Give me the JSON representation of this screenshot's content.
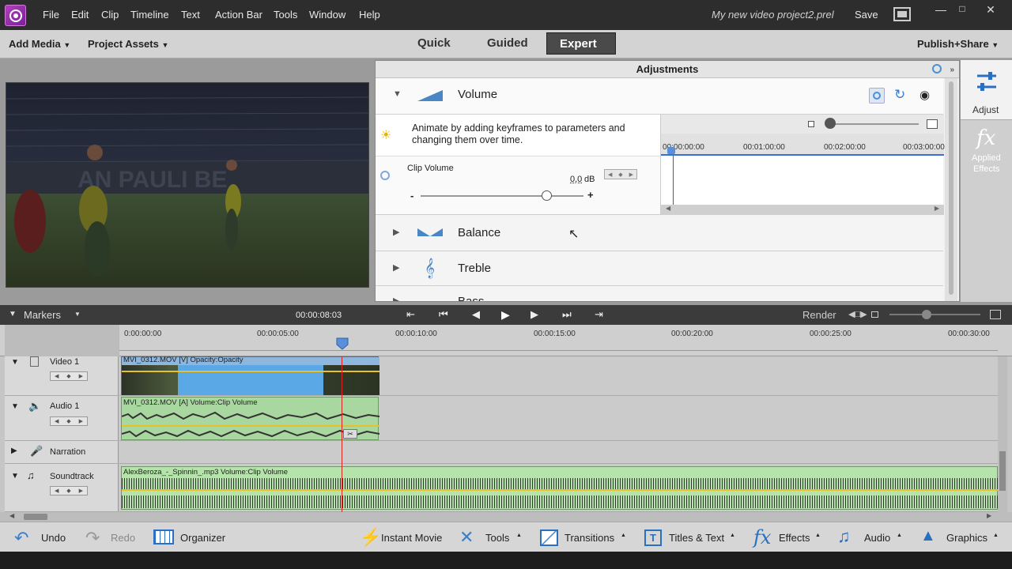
{
  "titlebar": {
    "menus": [
      "File",
      "Edit",
      "Clip",
      "Timeline",
      "Text",
      "Action Bar",
      "Tools",
      "Window",
      "Help"
    ],
    "project_name": "My new video project2.prel",
    "save_label": "Save"
  },
  "toolbar": {
    "add_media": "Add Media",
    "project_assets": "Project Assets",
    "modes": [
      "Quick",
      "Guided",
      "Expert"
    ],
    "active_mode": "Expert",
    "publish": "Publish+Share"
  },
  "adjustments": {
    "title": "Adjustments",
    "volume": {
      "label": "Volume",
      "tip": "Animate by adding keyframes to parameters and changing them over time.",
      "param_label": "Clip Volume",
      "value": "0,0",
      "unit": "dB",
      "minus": "-",
      "plus": "+",
      "slider_fraction": 0.77
    },
    "kf_times": [
      "00:00:00:00",
      "00:01:00:00",
      "00:02:00:00",
      "00:03:00:00"
    ],
    "sections": [
      "Balance",
      "Treble",
      "Bass"
    ]
  },
  "rightpanel": {
    "adjust": "Adjust",
    "applied_effects_1": "Applied",
    "applied_effects_2": "Effects",
    "fx": "fx"
  },
  "transport": {
    "markers": "Markers",
    "timecode": "00:00:08:03",
    "render": "Render"
  },
  "ruler": {
    "ticks": [
      "0:00:00:00",
      "00:00:05:00",
      "00:00:10:00",
      "00:00:15:00",
      "00:00:20:00",
      "00:00:25:00",
      "00:00:30:00"
    ]
  },
  "tracks": [
    {
      "name": "Video 1",
      "clip": "MVI_0312.MOV [V]  Opacity:Opacity"
    },
    {
      "name": "Audio 1",
      "clip": "MVI_0312.MOV [A]  Volume:Clip Volume"
    },
    {
      "name": "Narration",
      "clip": ""
    },
    {
      "name": "Soundtrack",
      "clip": "AlexBeroza_-_Spinnin_.mp3  Volume:Clip Volume"
    }
  ],
  "bottombar": {
    "undo": "Undo",
    "redo": "Redo",
    "organizer": "Organizer",
    "instant_movie": "Instant Movie",
    "tools": "Tools",
    "transitions": "Transitions",
    "titles": "Titles & Text",
    "effects": "Effects",
    "audio": "Audio",
    "graphics": "Graphics"
  },
  "colors": {
    "accent_blue": "#4a90d9",
    "audio_clip": "#a8d8a0",
    "video_clip": "#5aa9e6",
    "playhead": "#d22"
  }
}
